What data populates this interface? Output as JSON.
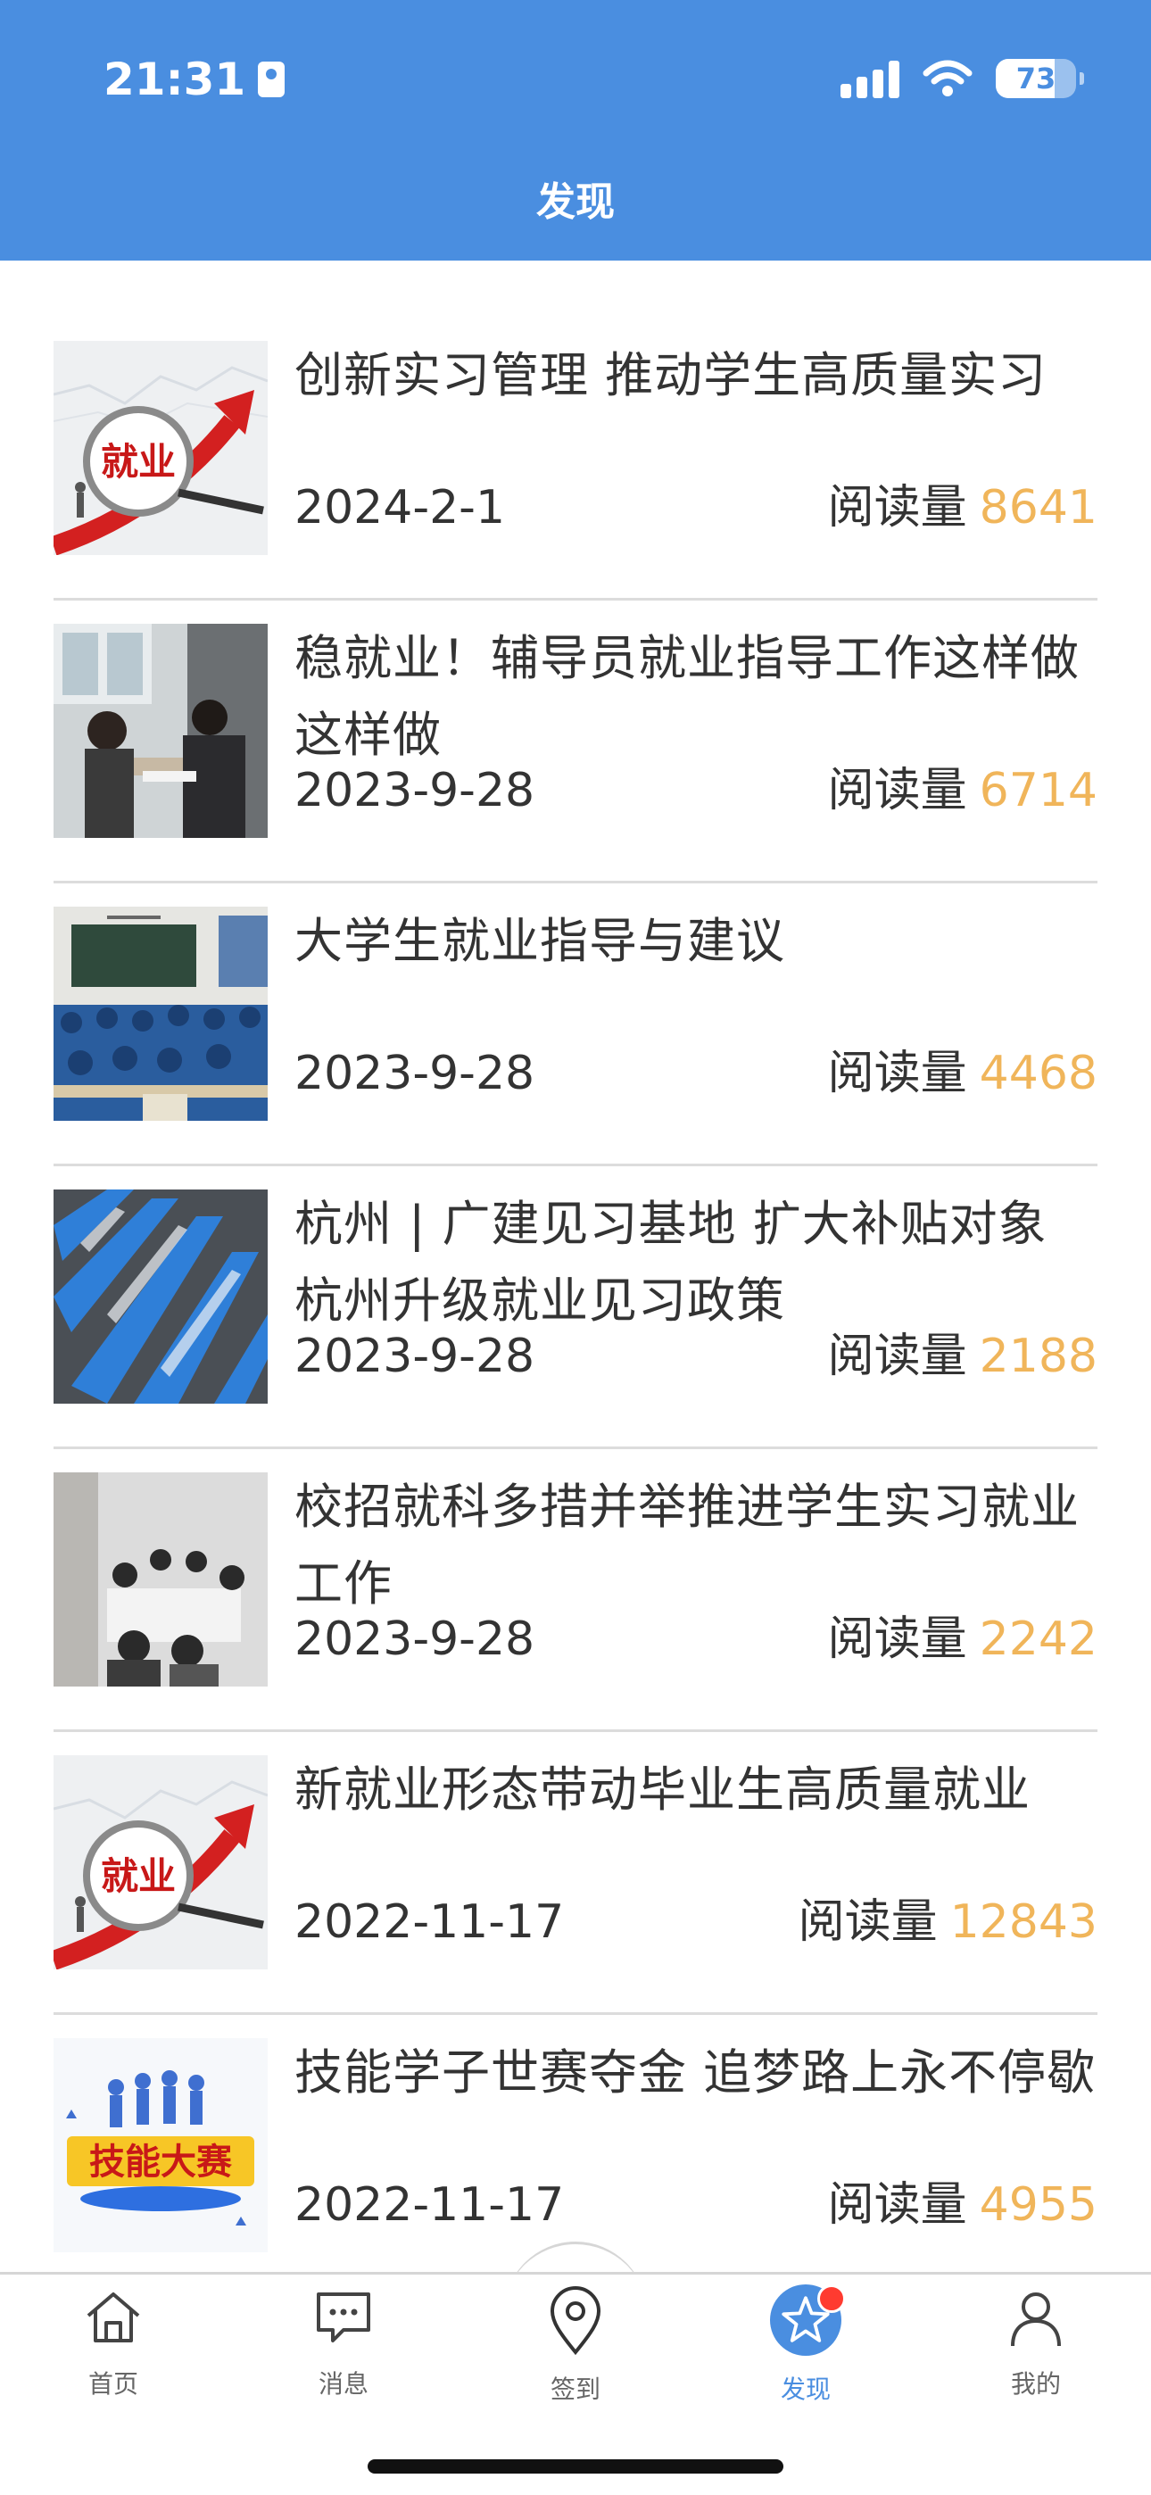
{
  "status": {
    "time": "21:31",
    "battery": "73",
    "battery_level": 0.73
  },
  "header": {
    "title": "发现"
  },
  "read_label": "阅读量",
  "articles": [
    {
      "title": "创新实习管理 推动学生高质量实习",
      "date": "2024-2-1",
      "reads": "8641",
      "image": "jiuye-magnifier"
    },
    {
      "title": "稳就业！辅导员就业指导工作这样做这样做",
      "date": "2023-9-28",
      "reads": "6714",
      "image": "counselor-meeting"
    },
    {
      "title": "大学生就业指导与建议",
      "date": "2023-9-28",
      "reads": "4468",
      "image": "classroom"
    },
    {
      "title": "杭州 | 广建见习基地 扩大补贴对象 杭州升级就业见习政策",
      "date": "2023-9-28",
      "reads": "2188",
      "image": "job-fair-tents"
    },
    {
      "title": "校招就科多措并举推进学生实习就业工作",
      "date": "2023-9-28",
      "reads": "2242",
      "image": "conference-room"
    },
    {
      "title": "新就业形态带动毕业生高质量就业",
      "date": "2022-11-17",
      "reads": "12843",
      "image": "jiuye-magnifier"
    },
    {
      "title": "技能学子世赛夺金 追梦路上永不停歇",
      "date": "2022-11-17",
      "reads": "4955",
      "image": "skills-contest"
    }
  ],
  "thumb_text": {
    "jiuye": "就业",
    "skills": "技能大赛"
  },
  "tabs": [
    {
      "label": "首页",
      "icon": "home-icon"
    },
    {
      "label": "消息",
      "icon": "message-icon"
    },
    {
      "label": "签到",
      "icon": "location-pin-icon"
    },
    {
      "label": "发现",
      "icon": "star-icon",
      "active": true
    },
    {
      "label": "我的",
      "icon": "user-icon"
    }
  ],
  "colors": {
    "header": "#4a8ee0",
    "accent": "#4a8ee0",
    "read_count": "#f0b55a",
    "badge": "#ff3b30"
  }
}
